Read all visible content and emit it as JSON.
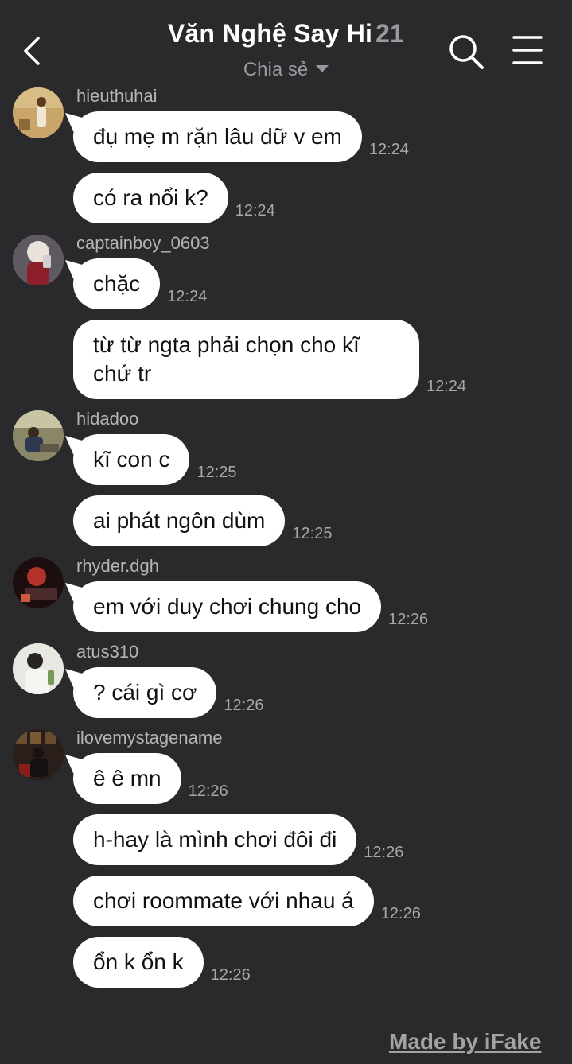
{
  "header": {
    "title": "Văn Nghệ Say Hi",
    "member_count": "21",
    "subtitle": "Chia sẻ"
  },
  "messages": [
    {
      "sender": "hieuthuhai",
      "avatar": "avatar-hieuthuhai",
      "avatar_color": "#b88a4a",
      "lines": [
        {
          "text": "đụ mẹ m rặn lâu dữ v em",
          "time": "12:24"
        },
        {
          "text": "có ra nổi k?",
          "time": "12:24"
        }
      ]
    },
    {
      "sender": "captainboy_0603",
      "avatar": "avatar-captainboy",
      "avatar_color": "#7a6a72",
      "lines": [
        {
          "text": "chặc",
          "time": "12:24"
        },
        {
          "text": "từ từ ngta phải chọn cho kĩ chứ tr",
          "time": "12:24"
        }
      ]
    },
    {
      "sender": "hidadoo",
      "avatar": "avatar-hidadoo",
      "avatar_color": "#7d7a5e",
      "lines": [
        {
          "text": "kĩ con c",
          "time": "12:25"
        },
        {
          "text": "ai phát ngôn dùm",
          "time": "12:25"
        }
      ]
    },
    {
      "sender": "rhyder.dgh",
      "avatar": "avatar-rhyder",
      "avatar_color": "#5a1c1c",
      "lines": [
        {
          "text": "em với duy chơi chung cho",
          "time": "12:26"
        }
      ]
    },
    {
      "sender": "atus310",
      "avatar": "avatar-atus",
      "avatar_color": "#d8d8d2",
      "lines": [
        {
          "text": "? cái gì cơ",
          "time": "12:26"
        }
      ]
    },
    {
      "sender": "ilovemystagename",
      "avatar": "avatar-ilovemystagename",
      "avatar_color": "#3b2a24",
      "lines": [
        {
          "text": "ê ê mn",
          "time": "12:26"
        },
        {
          "text": "h-hay là mình chơi đôi đi",
          "time": "12:26"
        },
        {
          "text": "chơi roommate với nhau á",
          "time": "12:26"
        },
        {
          "text": "ổn k ổn k",
          "time": "12:26"
        }
      ]
    }
  ],
  "watermark": "Made by iFake",
  "colors": {
    "background": "#2a2a2d",
    "bubble": "#ffffff",
    "bubble_text": "#111111",
    "muted": "#9a9a9e"
  },
  "icons": {
    "back": "chevron-left-icon",
    "search": "search-icon",
    "menu": "hamburger-menu-icon"
  }
}
